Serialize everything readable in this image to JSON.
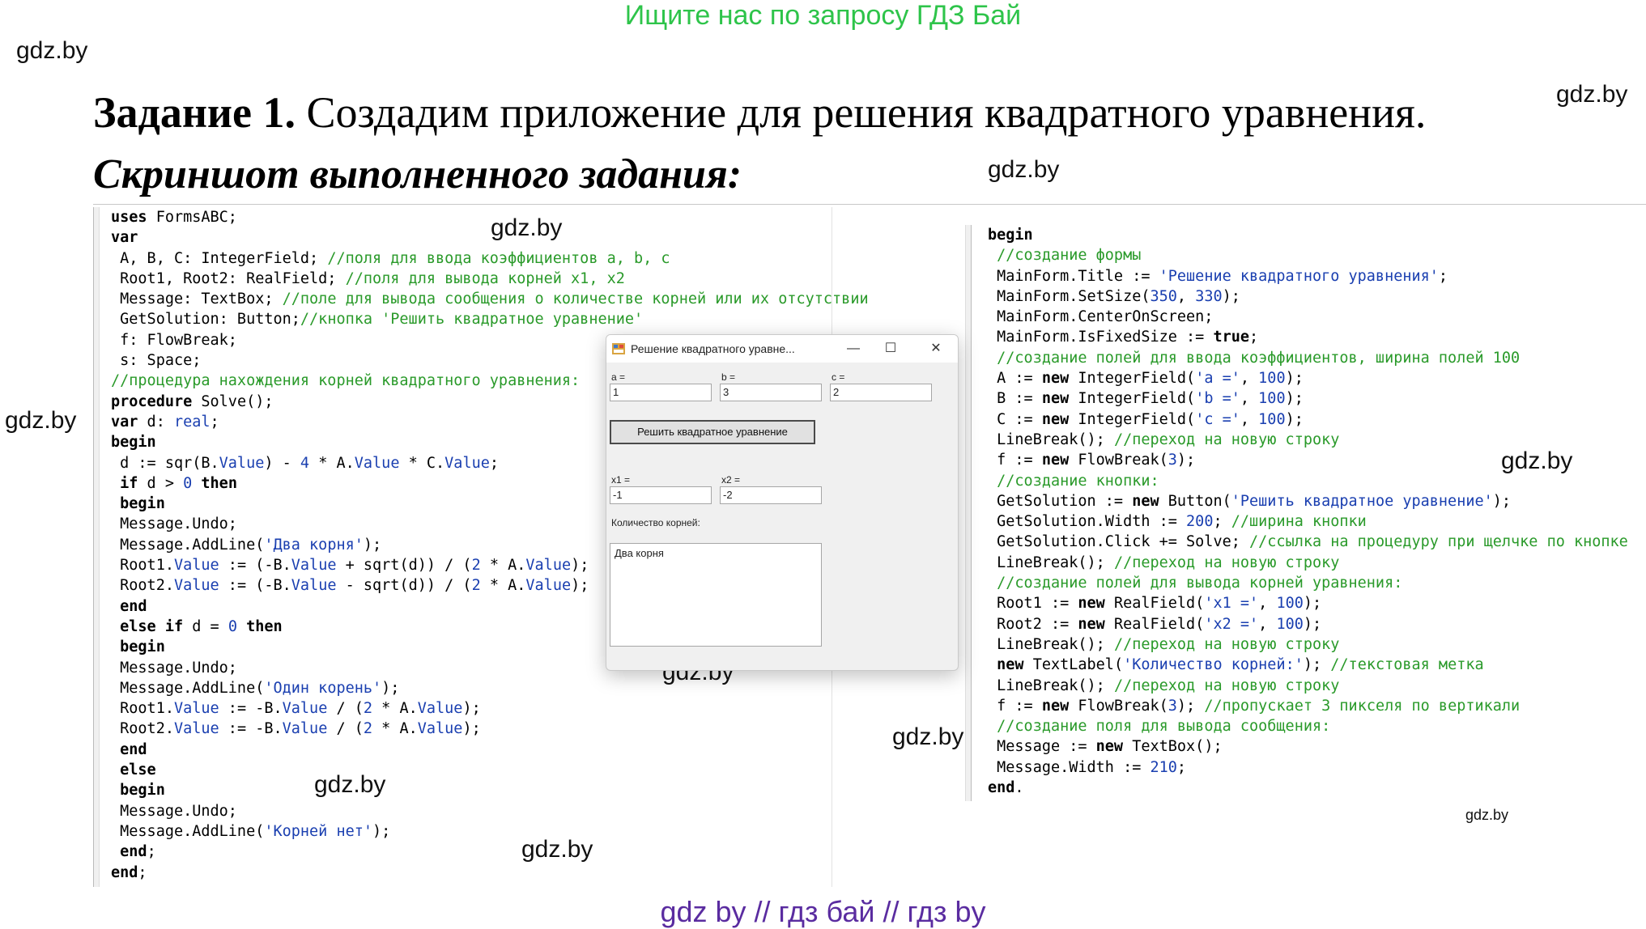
{
  "promo": "Ищите нас по запросу ГДЗ Бай",
  "watermark": "gdz.by",
  "task": {
    "number": "Задание 1.",
    "text": "Создадим приложение для решения квадратного уравнения.",
    "screenshot_caption": "Скриншот выполненного задания:"
  },
  "code_left": [
    "uses FormsABC;",
    "var",
    " A, B, C: IntegerField; //поля для ввода коэффициентов a, b, c",
    " Root1, Root2: RealField; //поля для вывода корней x1, x2",
    " Message: TextBox; //поле для вывода сообщения о количестве корней или их отсутствии",
    " GetSolution: Button;//кнопка 'Решить квадратное уравнение'",
    " f: FlowBreak;",
    " s: Space;",
    "//процедура нахождения корней квадратного уравнения:",
    "procedure Solve();",
    "var d: real;",
    "begin",
    " d := sqr(B.Value) - 4 * A.Value * C.Value;",
    " if d > 0 then",
    " begin",
    " Message.Undo;",
    " Message.AddLine('Два корня');",
    " Root1.Value := (-B.Value + sqrt(d)) / (2 * A.Value);",
    " Root2.Value := (-B.Value - sqrt(d)) / (2 * A.Value);",
    " end",
    " else if d = 0 then",
    " begin",
    " Message.Undo;",
    " Message.AddLine('Один корень');",
    " Root1.Value := -B.Value / (2 * A.Value);",
    " Root2.Value := -B.Value / (2 * A.Value);",
    " end",
    " else",
    " begin",
    " Message.Undo;",
    " Message.AddLine('Корней нет');",
    " end;",
    "end;"
  ],
  "code_right": [
    "begin",
    " //создание формы",
    " MainForm.Title := 'Решение квадратного уравнения';",
    " MainForm.SetSize(350, 330);",
    " MainForm.CenterOnScreen;",
    " MainForm.IsFixedSize := true;",
    " //создание полей для ввода коэффициентов, ширина полей 100",
    " A := new IntegerField('a =', 100);",
    " B := new IntegerField('b =', 100);",
    " C := new IntegerField('c =', 100);",
    " LineBreak(); //переход на новую строку",
    " f := new FlowBreak(3);",
    " //создание кнопки:",
    " GetSolution := new Button('Решить квадратное уравнение');",
    " GetSolution.Width := 200; //ширина кнопки",
    " GetSolution.Click += Solve; //ссылка на процедуру при щелчке по кнопке",
    " LineBreak(); //переход на новую строку",
    " //создание полей для вывода корней уравнения:",
    " Root1 := new RealField('x1 =', 100);",
    " Root2 := new RealField('x2 =', 100);",
    " LineBreak(); //переход на новую строку",
    " new TextLabel('Количество корней:'); //текстовая метка",
    " LineBreak(); //переход на новую строку",
    " f := new FlowBreak(3); //пропускает 3 пикселя по вертикали",
    " //создание поля для вывода сообщения:",
    " Message := new TextBox();",
    " Message.Width := 210;",
    "end."
  ],
  "window": {
    "title": "Решение квадратного уравне...",
    "minimize": "—",
    "maximize": "☐",
    "close": "✕",
    "a_label": "a =",
    "b_label": "b =",
    "c_label": "c =",
    "a_value": "1",
    "b_value": "3",
    "c_value": "2",
    "solve_button": "Решить квадратное уравнение",
    "x1_label": "x1 =",
    "x2_label": "x2 =",
    "x1_value": "-1",
    "x2_value": "-2",
    "count_label": "Количество корней:",
    "message_text": "Два корня"
  },
  "footer": "gdz by  //  гдз бай  //  гдз by"
}
